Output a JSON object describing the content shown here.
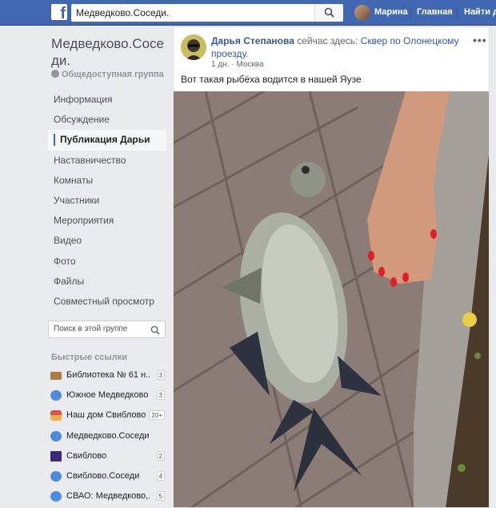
{
  "topbar": {
    "logo_letter": "f",
    "search_value": "Медведково.Соседи.",
    "user_name": "Марина",
    "home_label": "Главная",
    "find_friends_label": "Найти д"
  },
  "sidebar": {
    "group_title": "Медведково.Соседи.",
    "group_type": "Общедоступная группа",
    "nav": [
      {
        "label": "Информация"
      },
      {
        "label": "Обсуждение"
      },
      {
        "label": "Публикация Дарьи"
      },
      {
        "label": "Наставничество"
      },
      {
        "label": "Комнаты"
      },
      {
        "label": "Участники"
      },
      {
        "label": "Мероприятия"
      },
      {
        "label": "Видео"
      },
      {
        "label": "Фото"
      },
      {
        "label": "Файлы"
      },
      {
        "label": "Совместный просмотр"
      }
    ],
    "search_placeholder": "Поиск в этой группе",
    "quick_links_title": "Быстрые ссылки",
    "quick_links": [
      {
        "label": "Библиотека № 61 н...",
        "count": "3",
        "icon": "book-icon"
      },
      {
        "label": "Южное Медведково",
        "count": "3",
        "icon": "group-icon"
      },
      {
        "label": "Наш дом Свиблово",
        "count": "20+",
        "icon": "house-icon"
      },
      {
        "label": "Медведково.Соседи.",
        "count": "",
        "icon": "group-icon"
      },
      {
        "label": "Свиблово",
        "count": "2",
        "icon": "gc-icon"
      },
      {
        "label": "Свиблово.Соседи",
        "count": "4",
        "icon": "group-icon"
      },
      {
        "label": "СВАО: Медведково,...",
        "count": "5",
        "icon": "group-icon"
      }
    ]
  },
  "post": {
    "author": "Дарья Степанова",
    "location_prefix": " сейчас здесь: ",
    "location": "Сквер по Олонецкому проезду",
    "location_suffix": ".",
    "time": "1 дн.",
    "place": "Москва",
    "text": "Вот такая рыбёха водится в нашей Яузе"
  }
}
